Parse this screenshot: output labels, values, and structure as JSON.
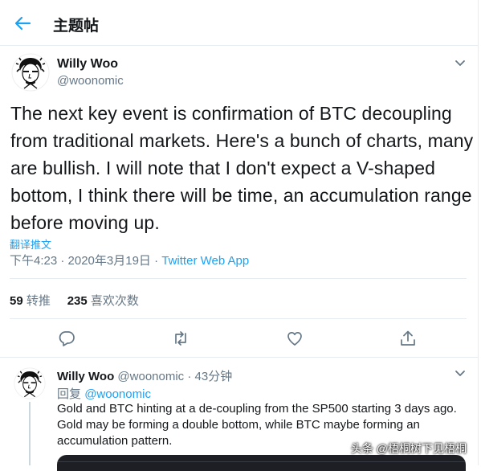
{
  "header": {
    "title": "主题帖"
  },
  "tweet": {
    "name": "Willy Woo",
    "handle": "@woonomic",
    "text": "The next key event is confirmation of BTC decoupling from traditional markets. Here's a bunch of charts, many are bullish. I will note that I don't expect a V-shaped bottom, I think there will be time, an accumulation range before moving up.",
    "translate_label": "翻译推文",
    "timestamp": "下午4:23 · 2020年3月19日",
    "separator": " · ",
    "source": "Twitter Web App",
    "retweets_count": "59",
    "retweets_label": "转推",
    "likes_count": "235",
    "likes_label": "喜欢次数"
  },
  "reply": {
    "name": "Willy Woo",
    "handle": "@woonomic",
    "time": " · 43分钟",
    "replying_prefix": "回复",
    "replying_to": "@woonomic",
    "text": "Gold and BTC hinting at a de-coupling from the SP500 starting 3 days ago. Gold may be forming a double bottom, while BTC maybe forming an accumulation pattern."
  },
  "watermark": "头条 @梧桐树下见梧桐",
  "colors": {
    "accent": "#1da1f2",
    "muted": "#657786",
    "text": "#14171a",
    "border": "#e6ecf0"
  },
  "icons": [
    "back-arrow-icon",
    "chevron-down-icon",
    "reply-icon",
    "retweet-icon",
    "like-icon",
    "share-icon"
  ]
}
